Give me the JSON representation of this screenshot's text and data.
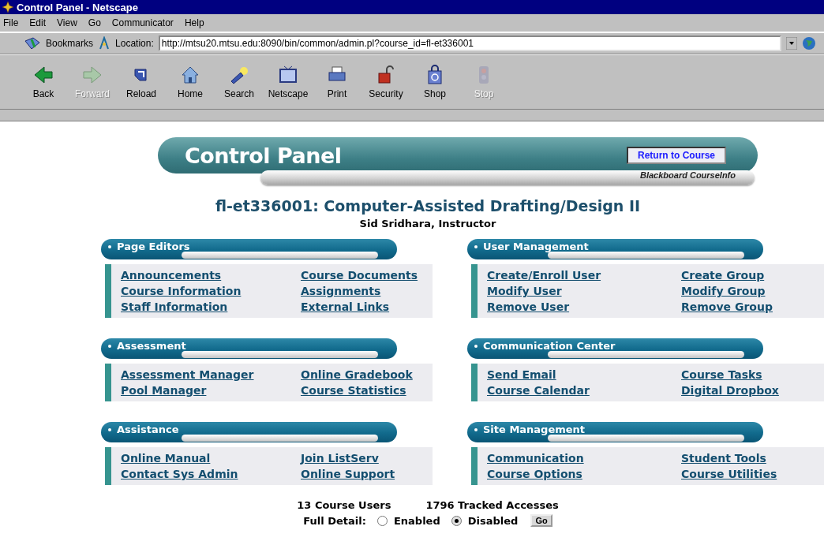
{
  "window": {
    "title": "Control Panel - Netscape"
  },
  "menu": [
    "File",
    "Edit",
    "View",
    "Go",
    "Communicator",
    "Help"
  ],
  "location_bar": {
    "bookmarks": "Bookmarks",
    "label": "Location:",
    "url": "http://mtsu20.mtsu.edu:8090/bin/common/admin.pl?course_id=fl-et336001"
  },
  "toolbar": [
    {
      "label": "Back",
      "disabled": false
    },
    {
      "label": "Forward",
      "disabled": true
    },
    {
      "label": "Reload",
      "disabled": false
    },
    {
      "label": "Home",
      "disabled": false
    },
    {
      "label": "Search",
      "disabled": false
    },
    {
      "label": "Netscape",
      "disabled": false
    },
    {
      "label": "Print",
      "disabled": false
    },
    {
      "label": "Security",
      "disabled": false
    },
    {
      "label": "Shop",
      "disabled": false
    },
    {
      "label": "Stop",
      "disabled": true
    }
  ],
  "banner": {
    "title": "Control Panel",
    "return_button": "Return to Course",
    "subtitle": "Blackboard CourseInfo"
  },
  "course_title": "fl-et336001: Computer-Assisted Drafting/Design II",
  "instructor": "Sid Sridhara, Instructor",
  "sections": [
    {
      "title": "Page Editors",
      "columns": [
        [
          "Announcements",
          "Course Information",
          "Staff Information"
        ],
        [
          "Course Documents",
          "Assignments",
          "External Links"
        ]
      ]
    },
    {
      "title": "User Management",
      "columns": [
        [
          "Create/Enroll User",
          "Modify User",
          "Remove User"
        ],
        [
          "Create Group",
          "Modify Group",
          "Remove Group"
        ]
      ]
    },
    {
      "title": "Assessment",
      "columns": [
        [
          "Assessment Manager",
          "Pool Manager"
        ],
        [
          "Online Gradebook",
          "Course Statistics"
        ]
      ]
    },
    {
      "title": "Communication Center",
      "columns": [
        [
          "Send Email",
          "Course Calendar"
        ],
        [
          "Course Tasks",
          "Digital Dropbox"
        ]
      ]
    },
    {
      "title": "Assistance",
      "columns": [
        [
          "Online Manual",
          "Contact Sys Admin"
        ],
        [
          "Join ListServ",
          "Online Support"
        ]
      ]
    },
    {
      "title": "Site Management",
      "columns": [
        [
          "Communication",
          "Course Options"
        ],
        [
          "Student Tools",
          "Course Utilities"
        ]
      ]
    }
  ],
  "stats": [
    "13 Course Users",
    "1796 Tracked Accesses"
  ],
  "full_detail": {
    "label": "Full Detail:",
    "options": [
      {
        "label": "Enabled",
        "selected": false
      },
      {
        "label": "Disabled",
        "selected": true
      }
    ],
    "button": "Go"
  }
}
